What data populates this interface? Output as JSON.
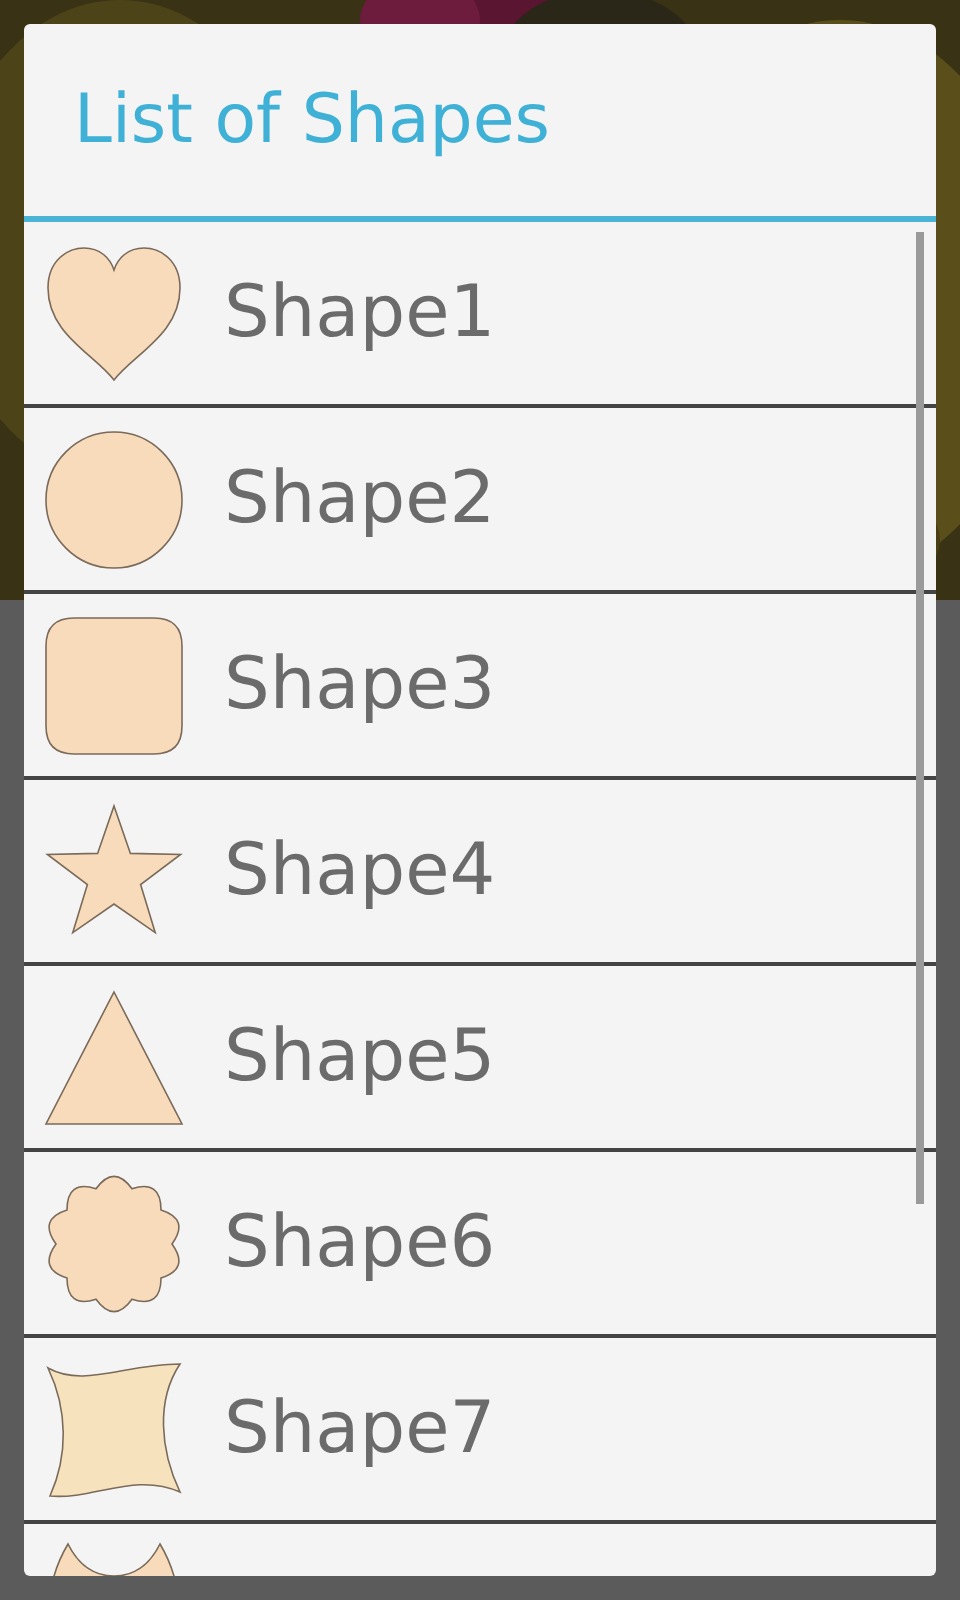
{
  "dialog": {
    "title": "List of Shapes"
  },
  "items": [
    {
      "kind": "heart",
      "label": "Shape1"
    },
    {
      "kind": "circle",
      "label": "Shape2"
    },
    {
      "kind": "rounded-square",
      "label": "Shape3"
    },
    {
      "kind": "star",
      "label": "Shape4"
    },
    {
      "kind": "triangle",
      "label": "Shape5"
    },
    {
      "kind": "scallop",
      "label": "Shape6"
    },
    {
      "kind": "wavy-square",
      "label": "Shape7"
    },
    {
      "kind": "horns"
    }
  ]
}
